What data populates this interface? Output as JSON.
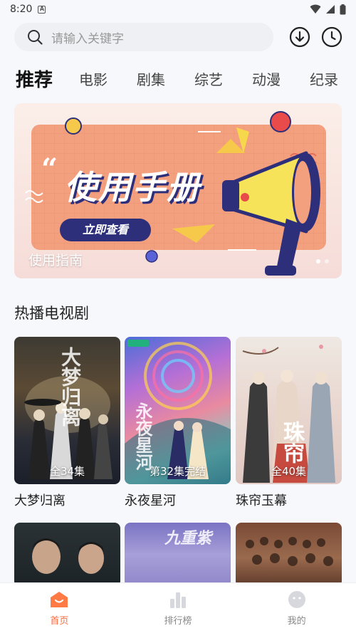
{
  "status_bar": {
    "time": "8:20"
  },
  "search": {
    "placeholder": "请输入关键字"
  },
  "tabs": [
    {
      "label": "推荐",
      "active": true
    },
    {
      "label": "电影"
    },
    {
      "label": "剧集"
    },
    {
      "label": "综艺"
    },
    {
      "label": "动漫"
    },
    {
      "label": "纪录"
    }
  ],
  "banner": {
    "headline": "使用手册",
    "button_label": "立即查看",
    "caption": "使用指南",
    "total_slides": 2,
    "active_slide": 1
  },
  "section": {
    "title": "热播电视剧"
  },
  "dramas": [
    {
      "title": "大梦归离",
      "badge": "全34集",
      "calligraphy": "大梦归离"
    },
    {
      "title": "永夜星河",
      "badge": "第32集完结",
      "calligraphy": "永夜星河"
    },
    {
      "title": "珠帘玉幕",
      "badge": "全40集",
      "calligraphy": "珠帘"
    },
    {
      "calligraphy": "九重紫"
    }
  ],
  "nav": [
    {
      "label": "首页",
      "active": true
    },
    {
      "label": "排行榜"
    },
    {
      "label": "我的"
    }
  ],
  "colors": {
    "accent": "#ff6a3d",
    "banner_orange": "#f3a07f",
    "banner_navy": "#2e2f7a"
  }
}
